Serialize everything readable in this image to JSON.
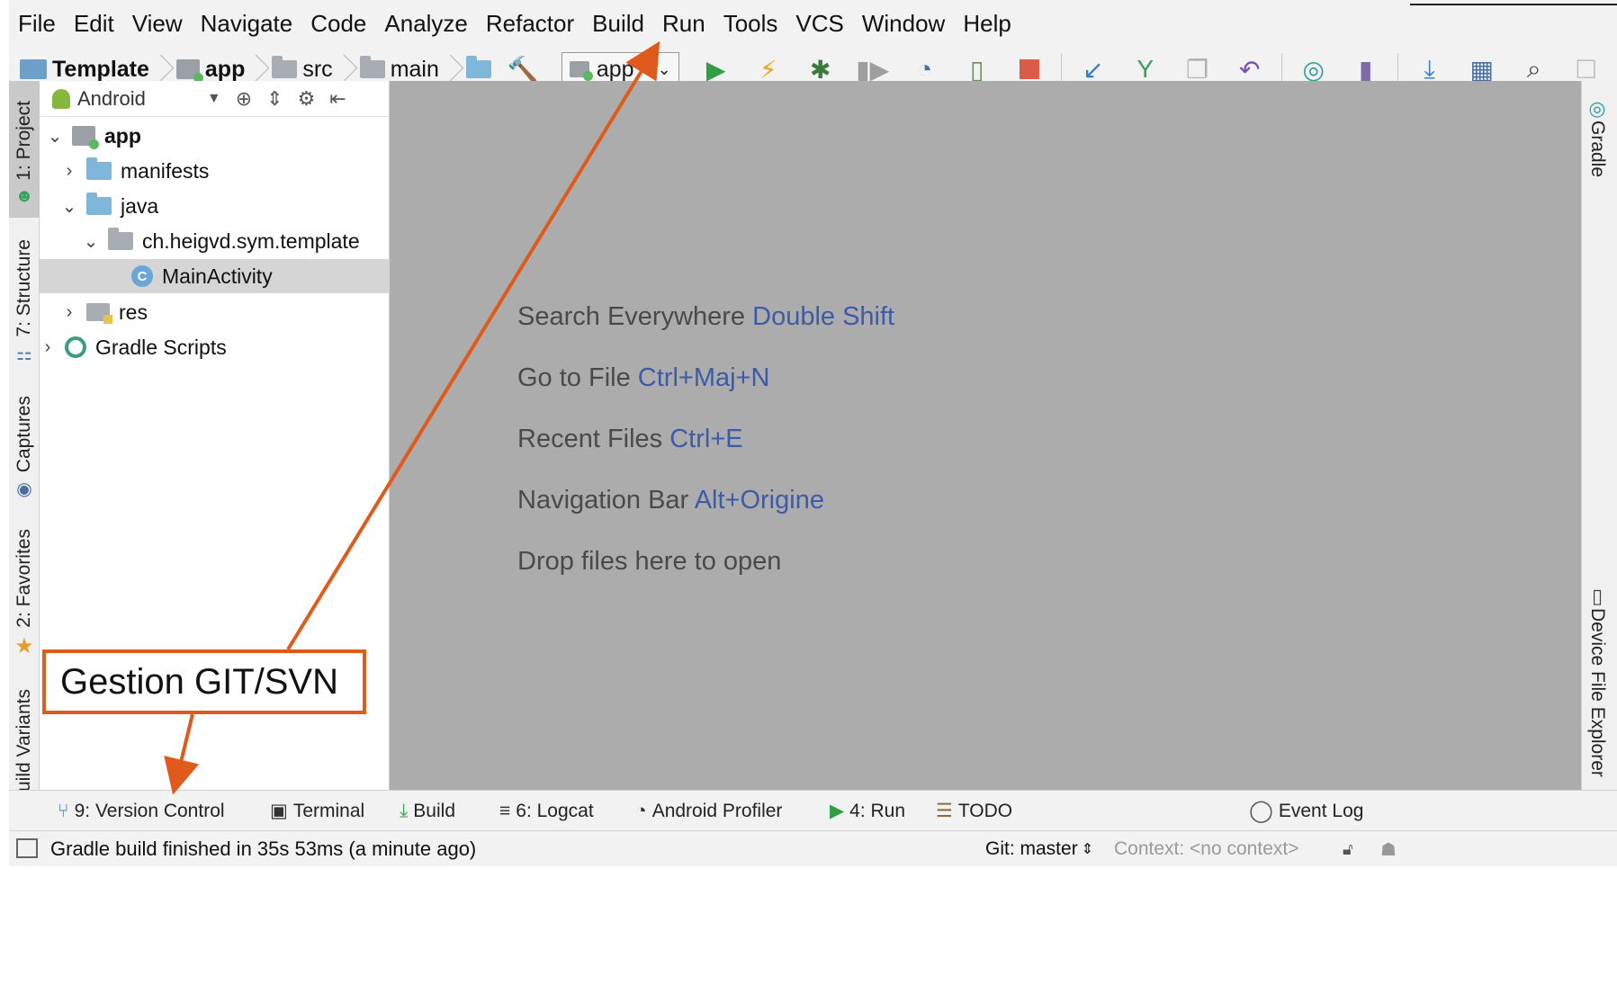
{
  "menubar": {
    "items": [
      "File",
      "Edit",
      "View",
      "Navigate",
      "Code",
      "Analyze",
      "Refactor",
      "Build",
      "Run",
      "Tools",
      "VCS",
      "Window",
      "Help"
    ]
  },
  "navbar": {
    "breadcrumbs": [
      "Template",
      "app",
      "src",
      "main"
    ],
    "run_config": "app"
  },
  "left_stripe": {
    "tabs": [
      "1: Project",
      "7: Structure",
      "Captures",
      "2: Favorites",
      "Build Variants"
    ]
  },
  "right_stripe": {
    "tabs": [
      "Gradle",
      "Device File Explorer"
    ]
  },
  "project_panel": {
    "view_selector": "Android",
    "tree": [
      {
        "label": "app",
        "bold": true
      },
      {
        "label": "manifests"
      },
      {
        "label": "java"
      },
      {
        "label": "ch.heigvd.sym.template"
      },
      {
        "label": "MainActivity",
        "selected": true
      },
      {
        "label": "res"
      },
      {
        "label": "Gradle Scripts"
      }
    ]
  },
  "editor": {
    "hints": [
      {
        "text": "Search Everywhere",
        "key": "Double Shift"
      },
      {
        "text": "Go to File",
        "key": "Ctrl+Maj+N"
      },
      {
        "text": "Recent Files",
        "key": "Ctrl+E"
      },
      {
        "text": "Navigation Bar",
        "key": "Alt+Origine"
      },
      {
        "text": "Drop files here to open",
        "key": ""
      }
    ]
  },
  "bottom_tools": {
    "items": [
      "9: Version Control",
      "Terminal",
      "Build",
      "6: Logcat",
      "Android Profiler",
      "4: Run",
      "TODO"
    ],
    "event_log": "Event Log"
  },
  "status_bar": {
    "message": "Gradle build finished in 35s 53ms (a minute ago)",
    "git_branch": "Git: master",
    "context": "Context: <no context>"
  },
  "annotation": {
    "label": "Gestion GIT/SVN",
    "color": "#e05a1c"
  },
  "colors": {
    "editor_bg": "#acacac",
    "shortcut_blue": "#3c5ba8",
    "selected_row": "#d5d5d5"
  }
}
